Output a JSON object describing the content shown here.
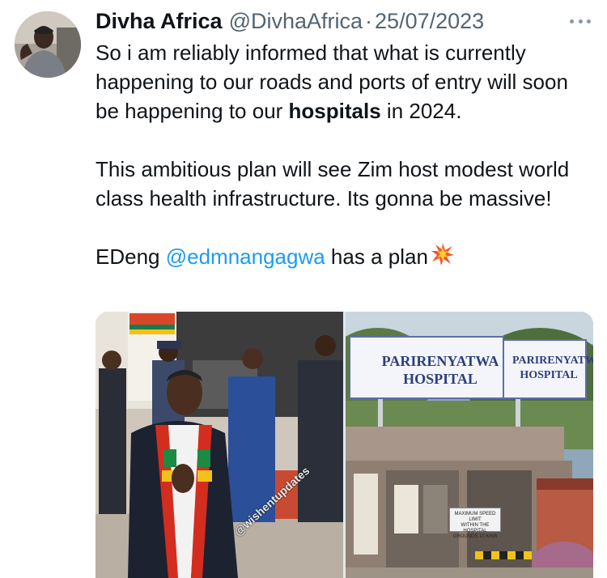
{
  "tweet": {
    "display_name": "Divha Africa",
    "handle": "@DivhaAfrica",
    "separator": "·",
    "date": "25/07/2023",
    "more_icon": "more-horizontal-icon",
    "avatar_icon": "user-avatar",
    "text": {
      "line1_part1": "So i am reliably informed that what is currently happening to our roads and ports of entry will soon be happening to our ",
      "line1_bold": "hospitals",
      "line1_part2": " in 2024.",
      "para2": "This ambitious plan will see Zim host modest world class health infrastructure. Its gonna be massive!",
      "para3_prefix": "EDeng ",
      "mention": "@edmnangagwa",
      "para3_suffix": " has a plan",
      "emoji": "sparkle-burst-icon"
    },
    "colors": {
      "mention": "#1d9bf0",
      "secondary": "#536471",
      "primary_text": "#0f1419"
    }
  },
  "media": {
    "left_photo": {
      "watermark": "@wishentupdates"
    },
    "right_photo": {
      "sign_main_line1": "PARIRENYATWA",
      "sign_main_line2": "HOSPITAL",
      "sign_side_line1": "PARIRENYATWA",
      "sign_side_line2": "HOSPITAL",
      "speed_sign_line1": "MAXIMUM SPEED LIMIT",
      "speed_sign_line2": "WITHIN THE HOSPITAL",
      "speed_sign_line3": "GROUNDS 10 Km/h"
    }
  }
}
